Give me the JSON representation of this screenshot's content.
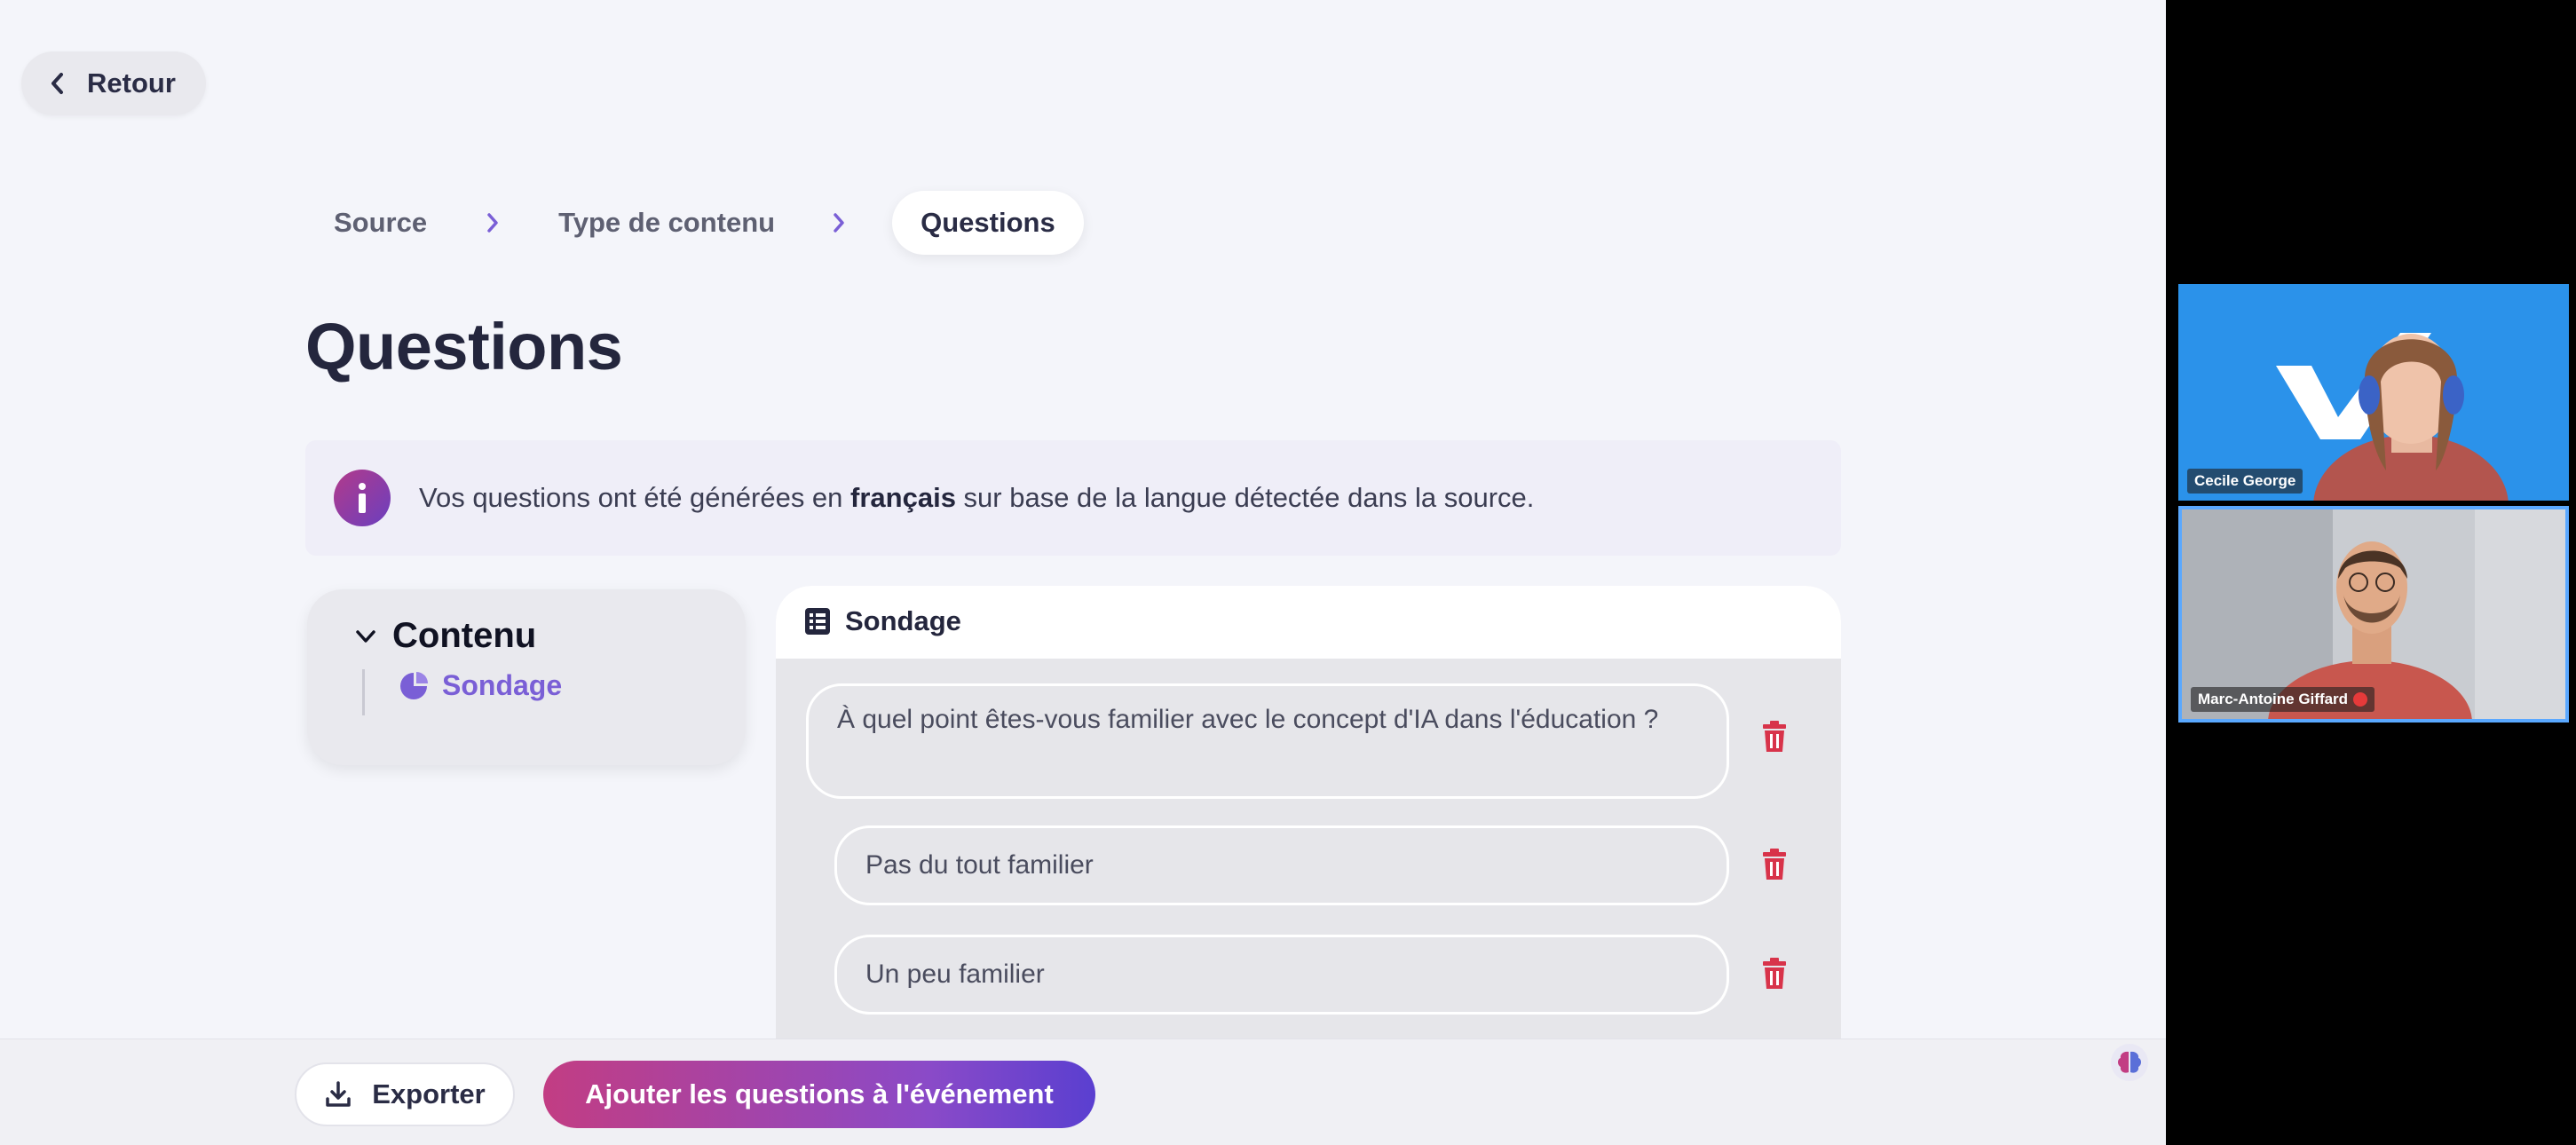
{
  "nav": {
    "back_label": "Retour"
  },
  "breadcrumb": {
    "steps": [
      "Source",
      "Type de contenu",
      "Questions"
    ]
  },
  "page": {
    "title": "Questions"
  },
  "info": {
    "text_before": "Vos questions ont été générées en ",
    "text_bold": "français",
    "text_after": " sur base de la langue détectée dans la source."
  },
  "sidebar": {
    "section_label": "Contenu",
    "item_label": "Sondage"
  },
  "survey": {
    "header_label": "Sondage",
    "question": "À quel point êtes-vous familier avec le concept d'IA dans l'éducation ?",
    "answers": [
      "Pas du tout familier",
      "Un peu familier"
    ]
  },
  "footer": {
    "export_label": "Exporter",
    "add_label": "Ajouter les questions à l'événement"
  },
  "participants": [
    {
      "name": "Cecile George"
    },
    {
      "name": "Marc-Antoine Giffard"
    }
  ],
  "colors": {
    "accent": "#7a5fd6",
    "danger": "#d8334a",
    "title": "#24263d"
  }
}
